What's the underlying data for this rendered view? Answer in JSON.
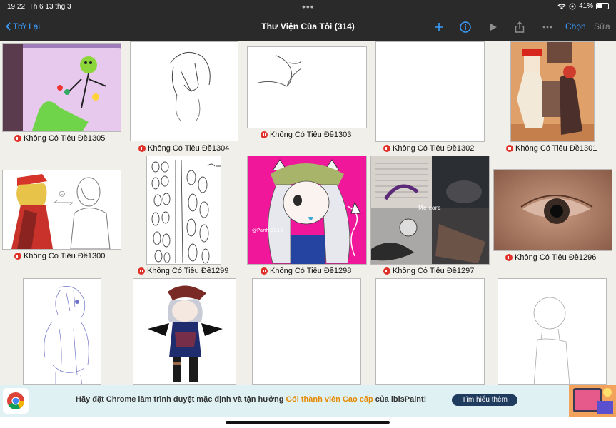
{
  "status_bar": {
    "time": "19:22",
    "date": "Th 6 13 thg 3",
    "battery": "41%",
    "battery_level": 0.41
  },
  "nav": {
    "back_label": "Trở Lại",
    "title": "Thư Viện Của Tôi (314)",
    "select_label": "Chọn",
    "edit_label": "Sửa"
  },
  "gallery": {
    "items": [
      {
        "caption": "Không Có Tiêu Đề1305"
      },
      {
        "caption": "Không Có Tiêu Đề1304"
      },
      {
        "caption": "Không Có Tiêu Đề1303"
      },
      {
        "caption": "Không Có Tiêu Đề1302"
      },
      {
        "caption": "Không Có Tiêu Đề1301"
      },
      {
        "caption": "Không Có Tiêu Đề1300"
      },
      {
        "caption": "Không Có Tiêu Đề1299"
      },
      {
        "caption": "Không Có Tiêu Đề1298"
      },
      {
        "caption": "Không Có Tiêu Đề1297"
      },
      {
        "caption": "Không Có Tiêu Đề1296"
      },
      {
        "caption": ""
      },
      {
        "caption": ""
      },
      {
        "caption": ""
      },
      {
        "caption": ""
      },
      {
        "caption": ""
      }
    ],
    "watermarks": {
      "art_1298": "@Panh 2k15",
      "art_1297": "Me core"
    }
  },
  "ad": {
    "message_part1": "Hãy đặt Chrome làm trình duyệt mặc định và tận hưởng ",
    "message_highlight": "Gói thành viên Cao cấp",
    "message_part2": " của ibisPaint!",
    "button_label": "Tìm hiểu thêm"
  },
  "colors": {
    "accent": "#3b9dff",
    "bar": "#2a2a2a",
    "background": "#f1efe9",
    "record_badge": "#e0312b",
    "ad_highlight": "#e58a00"
  }
}
